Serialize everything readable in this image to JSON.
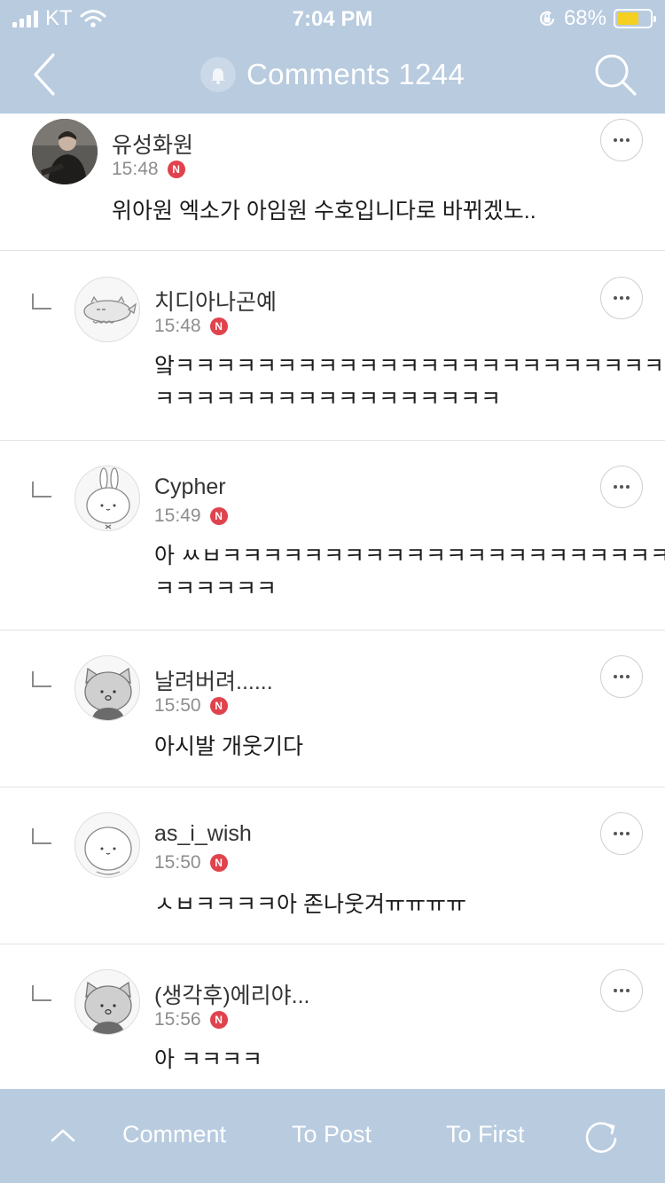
{
  "status_bar": {
    "carrier": "KT",
    "time": "7:04 PM",
    "battery": "68%",
    "battery_level": 0.68,
    "icons": [
      "signal-icon",
      "wifi-icon",
      "orientation-lock-icon",
      "battery-icon"
    ]
  },
  "header": {
    "title": "Comments 1244",
    "icons": [
      "back-icon",
      "bell-icon",
      "search-icon"
    ]
  },
  "comments": [
    {
      "name": "유성화원",
      "time": "15:48",
      "badge": "N",
      "reply": false,
      "lines": [
        "위아원 엑소가 아임원 수호입니다로 바뀌겠노.."
      ]
    },
    {
      "name": "치디아나곤예",
      "time": "15:48",
      "badge": "N",
      "reply": true,
      "lines": [
        "앜ㅋㅋㅋㅋㅋㅋㅋㅋㅋㅋㅋㅋㅋㅋㅋㅋㅋㅋㅋㅋㅋㅋㅋㅋㅋ",
        "ㅋㅋㅋㅋㅋㅋㅋㅋㅋㅋㅋㅋㅋㅋㅋㅋㅋ"
      ]
    },
    {
      "name": "Cypher",
      "time": "15:49",
      "badge": "N",
      "reply": true,
      "lines": [
        "아 ㅆㅂㅋㅋㅋㅋㅋㅋㅋㅋㅋㅋㅋㅋㅋㅋㅋㅋㅋㅋㅋㅋㅋㅋ",
        "ㅋㅋㅋㅋㅋㅋ"
      ]
    },
    {
      "name": "날려버려......",
      "time": "15:50",
      "badge": "N",
      "reply": true,
      "lines": [
        "아시발 개웃기다"
      ]
    },
    {
      "name": "as_i_wish",
      "time": "15:50",
      "badge": "N",
      "reply": true,
      "lines": [
        "ㅅㅂㅋㅋㅋㅋ아 존나웃겨ㅠㅠㅠㅠ"
      ]
    },
    {
      "name": "(생각후)에리야...",
      "time": "15:56",
      "badge": "N",
      "reply": true,
      "lines": [
        "아 ㅋㅋㅋㅋ"
      ]
    }
  ],
  "bottom_bar": {
    "comment": "Comment",
    "to_post": "To Post",
    "to_first": "To First",
    "icons": [
      "chevron-up-icon",
      "refresh-icon"
    ]
  },
  "colors": {
    "bar": "#b8cbdf",
    "badge": "#e0434d",
    "battery": "#f5d020"
  }
}
